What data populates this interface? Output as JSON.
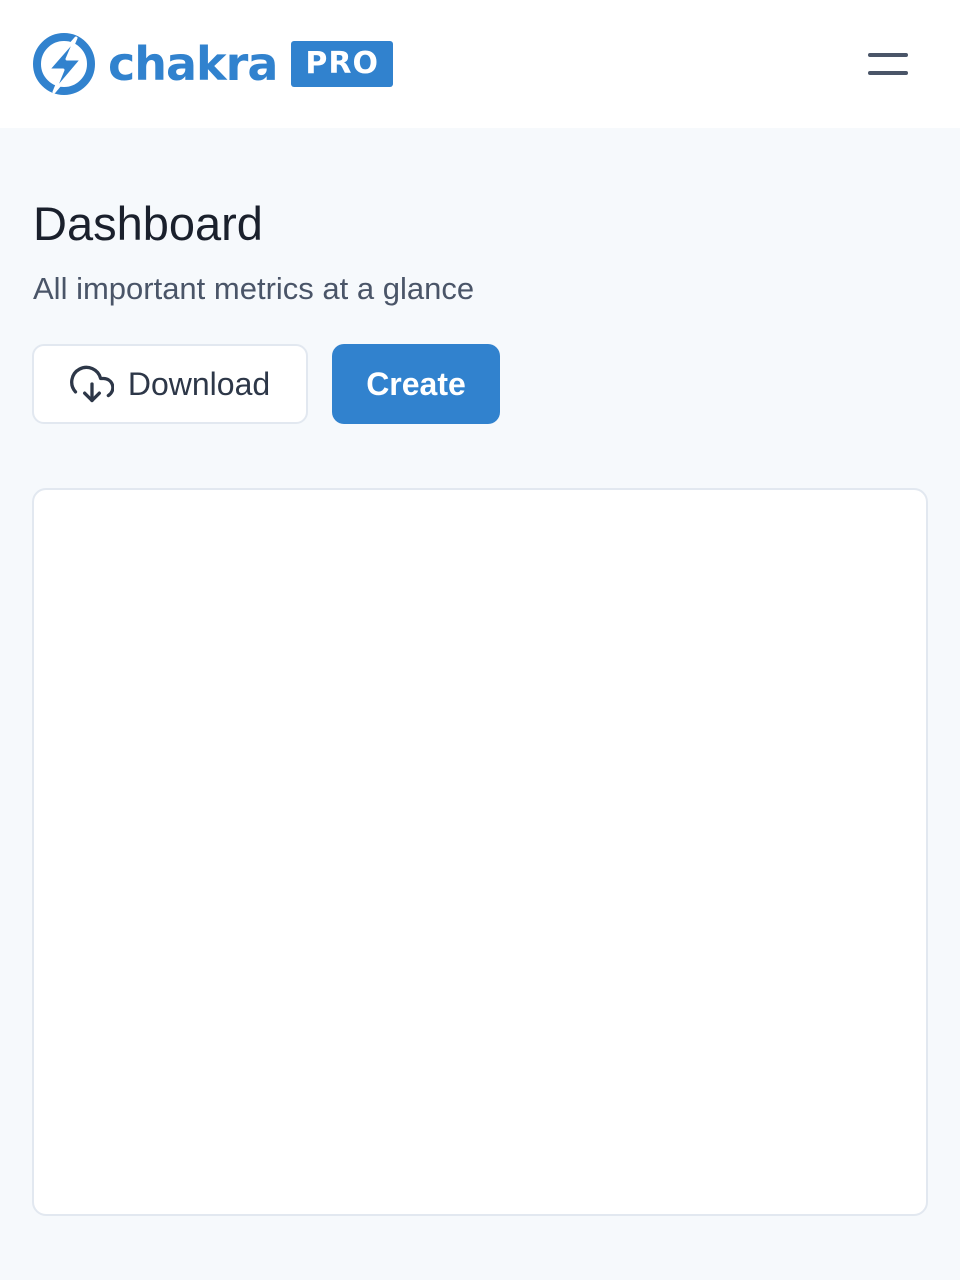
{
  "colors": {
    "brand": "#3182ce",
    "page_background": "#f6f9fc",
    "text_dark": "#1a202c",
    "text_muted": "#4a5568"
  },
  "header": {
    "logo": {
      "icon": "lightning-bolt-logo-icon",
      "wordmark": "chakra",
      "badge": "PRO"
    },
    "menu_icon": "hamburger-menu-icon"
  },
  "main": {
    "title": "Dashboard",
    "subtitle": "All important metrics at a glance",
    "actions": {
      "download": {
        "label": "Download",
        "icon": "cloud-download-icon"
      },
      "create": {
        "label": "Create"
      }
    }
  }
}
